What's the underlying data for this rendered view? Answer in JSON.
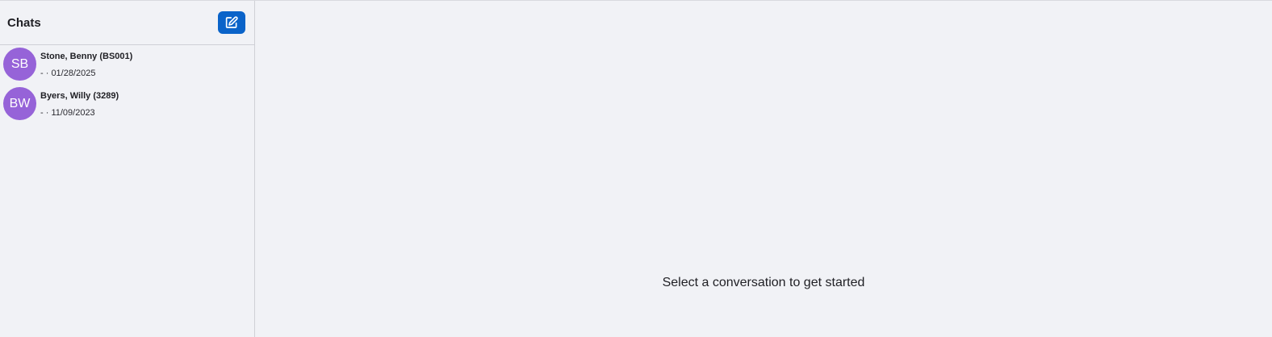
{
  "sidebar": {
    "title": "Chats",
    "new_chat_icon": "edit-square-icon",
    "items": [
      {
        "initials": "SB",
        "name": "Stone, Benny (BS001)",
        "meta": "- · 01/28/2025"
      },
      {
        "initials": "BW",
        "name": "Byers, Willy (3289)",
        "meta": "- · 11/09/2023"
      }
    ]
  },
  "main": {
    "empty_message": "Select a conversation to get started"
  },
  "colors": {
    "accent": "#0a63c9",
    "avatar": "#9663d8",
    "background": "#f1f2f6"
  }
}
